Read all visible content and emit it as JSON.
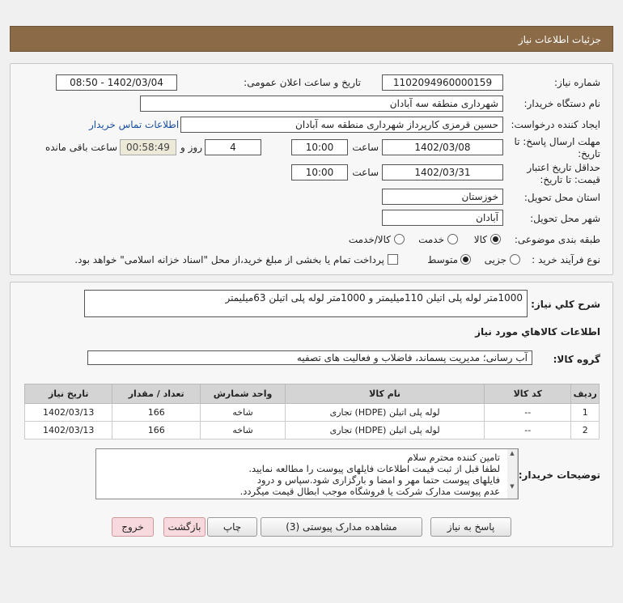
{
  "header": {
    "title": "جزئیات اطلاعات نیاز"
  },
  "form": {
    "need_number_label": "شماره نیاز:",
    "need_number": "1102094960000159",
    "announce_label": "تاریخ و ساعت اعلان عمومی:",
    "announce_value": "1402/03/04 - 08:50",
    "buyer_org_label": "نام دستگاه خریدار:",
    "buyer_org": "شهرداری منطقه سه آبادان",
    "creator_label": "ایجاد کننده درخواست:",
    "creator": "حسین قرمزی کارپرداز شهرداری منطقه سه آبادان",
    "contact_link": "اطلاعات تماس خریدار",
    "deadline_label_1": "مهلت ارسال پاسخ: تا",
    "deadline_label_2": "تاریخ:",
    "deadline_date": "1402/03/08",
    "time_label": "ساعت",
    "deadline_time": "10:00",
    "days_value": "4",
    "days_label": "روز و",
    "remaining_time": "00:58:49",
    "remaining_label": "ساعت باقی مانده",
    "validity_label_1": "حداقل تاریخ اعتبار",
    "validity_label_2": "قیمت: تا تاریخ:",
    "validity_date": "1402/03/31",
    "validity_time": "10:00",
    "province_label": "استان محل تحویل:",
    "province": "خوزستان",
    "city_label": "شهر محل تحویل:",
    "city": "آبادان",
    "category_label": "طبقه بندی موضوعی:",
    "category_options": [
      "کالا",
      "خدمت",
      "کالا/خدمت"
    ],
    "category_selected": "کالا",
    "process_label": "نوع فرآیند خرید :",
    "process_options": [
      "جزیی",
      "متوسط"
    ],
    "process_selected": "متوسط",
    "payment_note": "پرداخت تمام یا بخشی از مبلغ خرید،از محل \"اسناد خزانه اسلامی\" خواهد بود."
  },
  "summary": {
    "title_label": "شرح کلي نياز:",
    "title_value": "1000متر لوله پلی اتیلن 110میلیمتر و 1000متر لوله پلی اتیلن 63میلیمتر",
    "goods_info_label": "اطلاعات کالاهاي مورد نياز",
    "group_label": "گروه کالا:",
    "group_value": "آب رسانی؛ مدیریت پسماند، فاضلاب و فعالیت های تصفیه"
  },
  "table": {
    "columns": [
      "ردیف",
      "کد کالا",
      "نام کالا",
      "واحد شمارش",
      "تعداد / مقدار",
      "تاریخ نیاز"
    ],
    "rows": [
      [
        "1",
        "--",
        "لوله پلی اتیلن (HDPE) تجاری",
        "شاخه",
        "166",
        "1402/03/13"
      ],
      [
        "2",
        "--",
        "لوله پلی اتیلن (HDPE) تجاری",
        "شاخه",
        "166",
        "1402/03/13"
      ]
    ]
  },
  "buyer_notes": {
    "label": "توضیحات خریدار:",
    "lines": [
      "تامین کننده محترم سلام",
      "لطفا قبل از ثبت قیمت اطلاعات فایلهای پیوست را مطالعه نمایید.",
      "فایلهای پیوست حتما مهر و امضا و بارگزاری شود.سپاس و درود",
      "عدم پیوست مدارک شرکت یا فروشگاه موجب ابطال قیمت میگردد."
    ]
  },
  "buttons": {
    "reply": "پاسخ به نیاز",
    "attachments": "مشاهده مدارک پیوستی (3)",
    "print": "چاپ",
    "back": "بازگشت",
    "exit": "خروج"
  },
  "colors": {
    "header": "#8b6a47",
    "accent_link": "#1a4fa0",
    "pink_button": "#f7d9de"
  }
}
